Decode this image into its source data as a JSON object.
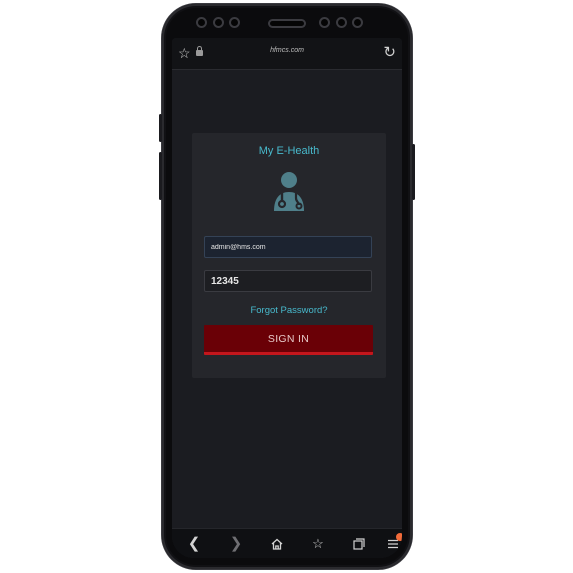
{
  "browser": {
    "url": "hfmcs.com",
    "icons": {
      "favorite": "star-outline-icon",
      "secure": "lock-icon",
      "reload": "reload-icon"
    }
  },
  "login": {
    "title": "My E-Health",
    "avatar_icon": "doctor-stethoscope-icon",
    "email_value": "admin@hms.com",
    "password_value": "12345",
    "forgot_label": "Forgot Password?",
    "signin_label": "SIGN IN"
  },
  "nav": {
    "icons": [
      "back-icon",
      "forward-icon",
      "home-icon",
      "bookmarks-icon",
      "tabs-icon",
      "menu-icon"
    ]
  },
  "colors": {
    "accent": "#48b9cc",
    "signin_bg": "#6a0006",
    "signin_border": "#c4161c",
    "card_bg": "#25262b",
    "screen_bg": "#1b1c21",
    "notification_dot": "#f26b3a"
  }
}
